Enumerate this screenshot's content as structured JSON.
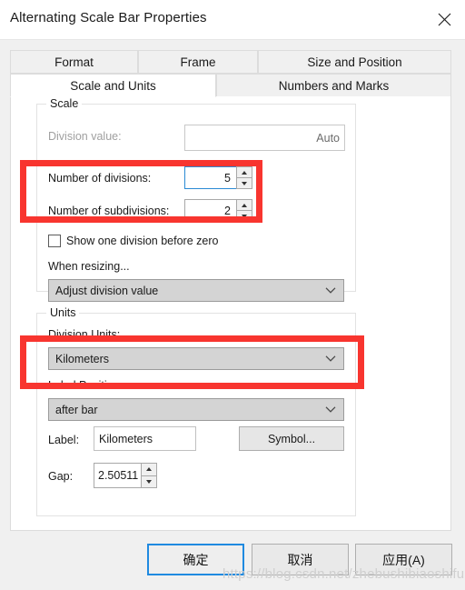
{
  "window": {
    "title": "Alternating Scale Bar Properties",
    "close_icon": "close-icon"
  },
  "tabs": {
    "row1": [
      {
        "label": "Format",
        "selected": false
      },
      {
        "label": "Frame",
        "selected": false
      },
      {
        "label": "Size and Position",
        "selected": false
      }
    ],
    "row2": [
      {
        "label": "Scale and Units",
        "selected": true
      },
      {
        "label": "Numbers and Marks",
        "selected": false
      }
    ]
  },
  "scale_group": {
    "legend": "Scale",
    "division_value_label": "Division value:",
    "division_value_text": "Auto",
    "number_of_divisions_label": "Number of divisions:",
    "number_of_divisions_value": "5",
    "number_of_subdivisions_label": "Number of subdivisions:",
    "number_of_subdivisions_value": "2",
    "show_one_division_label": "Show one division before zero",
    "show_one_division_checked": false,
    "when_resizing_label": "When resizing...",
    "when_resizing_value": "Adjust division value"
  },
  "units_group": {
    "legend": "Units",
    "division_units_label": "Division Units:",
    "division_units_value": "Kilometers",
    "label_position_label": "Label Position:",
    "label_position_value": "after bar",
    "label_label": "Label:",
    "label_value": "Kilometers",
    "symbol_button": "Symbol...",
    "gap_label": "Gap:",
    "gap_value": "2.50511"
  },
  "footer": {
    "ok": "确定",
    "cancel": "取消",
    "apply": "应用(A)"
  },
  "annotations": {
    "highlight_color": "#f8352f",
    "watermark": "https://blog.csdn.net/zhebushibiaoshifu"
  }
}
